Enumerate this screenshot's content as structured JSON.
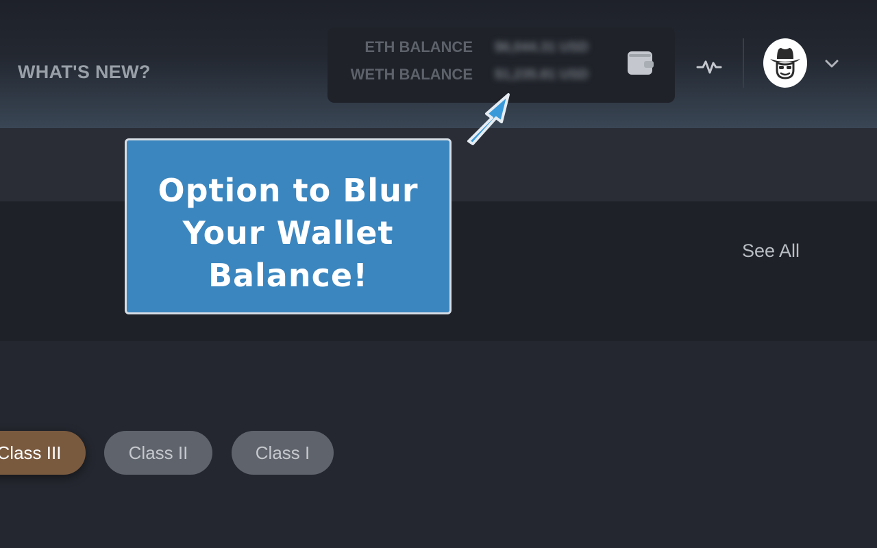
{
  "header": {
    "whats_new": "WHAT'S NEW?"
  },
  "balances": {
    "eth_label": "ETH BALANCE",
    "eth_value": "$6,044.31 USD",
    "weth_label": "WETH BALANCE",
    "weth_value": "$1,235.81 USD",
    "blurred": true
  },
  "icons": {
    "wallet": "wallet-icon",
    "activity": "activity-icon",
    "avatar": "cowboy-avatar",
    "dropdown": "chevron-down-icon"
  },
  "section": {
    "see_all": "See All"
  },
  "classes": {
    "active": "Class III",
    "items": [
      "Class II",
      "Class I"
    ]
  },
  "callout": {
    "line1": "Option to Blur",
    "line2": "Your Wallet",
    "line3": "Balance!"
  },
  "colors": {
    "accent_callout": "#3b86bf",
    "arrow": "#3a9ad9",
    "active_pill": "#7a5a3f",
    "inactive_pill": "#5f636b"
  }
}
